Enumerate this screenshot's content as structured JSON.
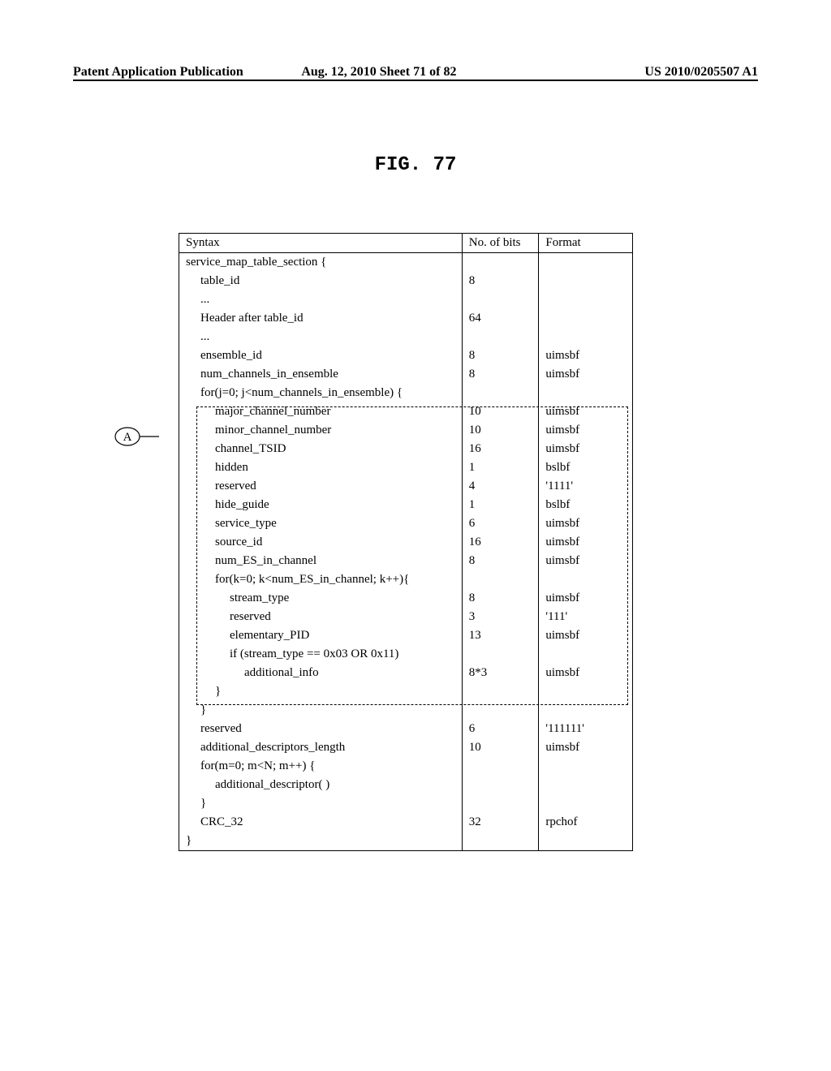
{
  "header": {
    "left": "Patent Application Publication",
    "center": "Aug. 12, 2010  Sheet 71 of 82",
    "right": "US 2010/0205507 A1"
  },
  "figure_title": "FIG. 77",
  "table_headers": {
    "syntax": "Syntax",
    "bits": "No. of bits",
    "format": "Format"
  },
  "rows": [
    {
      "syntax": "service_map_table_section {",
      "ind": 0,
      "bits": "",
      "format": ""
    },
    {
      "syntax": "table_id",
      "ind": 1,
      "bits": "8",
      "format": ""
    },
    {
      "syntax": "...",
      "ind": 1,
      "bits": "",
      "format": ""
    },
    {
      "syntax": "Header after table_id",
      "ind": 1,
      "bits": "64",
      "format": ""
    },
    {
      "syntax": "...",
      "ind": 1,
      "bits": "",
      "format": ""
    },
    {
      "syntax": "ensemble_id",
      "ind": 1,
      "bits": "8",
      "format": "uimsbf"
    },
    {
      "syntax": "num_channels_in_ensemble",
      "ind": 1,
      "bits": "8",
      "format": "uimsbf"
    },
    {
      "syntax": "for(j=0; j<num_channels_in_ensemble) {",
      "ind": 1,
      "bits": "",
      "format": ""
    },
    {
      "syntax": "major_channel_number",
      "ind": 2,
      "bits": "10",
      "format": "uimsbf"
    },
    {
      "syntax": "minor_channel_number",
      "ind": 2,
      "bits": "10",
      "format": "uimsbf"
    },
    {
      "syntax": "channel_TSID",
      "ind": 2,
      "bits": "16",
      "format": "uimsbf"
    },
    {
      "syntax": "hidden",
      "ind": 2,
      "bits": "1",
      "format": "bslbf"
    },
    {
      "syntax": "reserved",
      "ind": 2,
      "bits": "4",
      "format": "'1111'"
    },
    {
      "syntax": "hide_guide",
      "ind": 2,
      "bits": "1",
      "format": "bslbf"
    },
    {
      "syntax": "service_type",
      "ind": 2,
      "bits": "6",
      "format": "uimsbf"
    },
    {
      "syntax": "source_id",
      "ind": 2,
      "bits": "16",
      "format": "uimsbf"
    },
    {
      "syntax": "num_ES_in_channel",
      "ind": 2,
      "bits": "8",
      "format": "uimsbf"
    },
    {
      "syntax": "for(k=0; k<num_ES_in_channel; k++){",
      "ind": 2,
      "bits": "",
      "format": ""
    },
    {
      "syntax": "stream_type",
      "ind": 3,
      "bits": "8",
      "format": "uimsbf"
    },
    {
      "syntax": "reserved",
      "ind": 3,
      "bits": "3",
      "format": "'111'"
    },
    {
      "syntax": "elementary_PID",
      "ind": 3,
      "bits": "13",
      "format": "uimsbf"
    },
    {
      "syntax": "if (stream_type == 0x03 OR 0x11)",
      "ind": 3,
      "bits": "",
      "format": ""
    },
    {
      "syntax": "additional_info",
      "ind": 4,
      "bits": "8*3",
      "format": "uimsbf"
    },
    {
      "syntax": "}",
      "ind": 2,
      "bits": "",
      "format": ""
    },
    {
      "syntax": "}",
      "ind": 1,
      "bits": "",
      "format": ""
    },
    {
      "syntax": "reserved",
      "ind": 1,
      "bits": "6",
      "format": "'111111'"
    },
    {
      "syntax": "additional_descriptors_length",
      "ind": 1,
      "bits": "10",
      "format": "uimsbf"
    },
    {
      "syntax": "for(m=0; m<N; m++) {",
      "ind": 1,
      "bits": "",
      "format": ""
    },
    {
      "syntax": "additional_descriptor( )",
      "ind": 2,
      "bits": "",
      "format": ""
    },
    {
      "syntax": "}",
      "ind": 1,
      "bits": "",
      "format": ""
    },
    {
      "syntax": "CRC_32",
      "ind": 1,
      "bits": "32",
      "format": "rpchof"
    },
    {
      "syntax": "}",
      "ind": 0,
      "bits": "",
      "format": ""
    }
  ],
  "annotation_label": "A"
}
